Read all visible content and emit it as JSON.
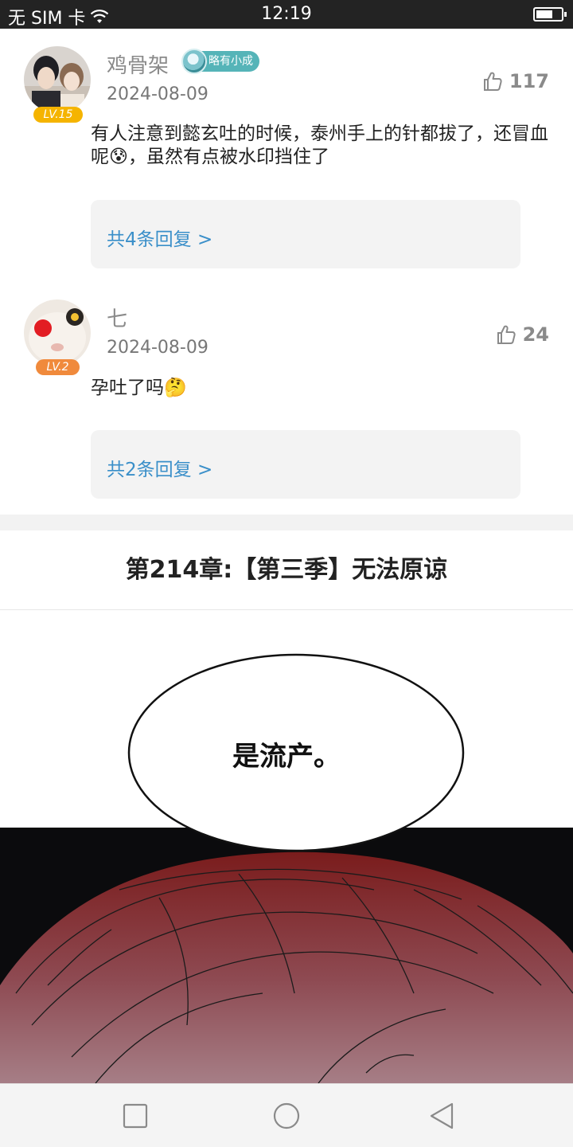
{
  "status_bar": {
    "carrier": "无 SIM 卡",
    "time": "12:19"
  },
  "comments": [
    {
      "username": "鸡骨架",
      "level": "LV.15",
      "level_color": "#f5b400",
      "title_badge": "略有小成",
      "date": "2024-08-09",
      "likes": "117",
      "text": "有人注意到懿玄吐的时候，泰州手上的针都拔了，还冒血呢😰，虽然有点被水印挡住了",
      "replies": "共4条回复 >"
    },
    {
      "username": "七",
      "level": "LV.2",
      "level_color": "#f08a3c",
      "date": "2024-08-09",
      "likes": "24",
      "text": "孕吐了吗🤔",
      "replies": "共2条回复 >"
    }
  ],
  "chapter": {
    "title": "第214章:【第三季】无法原谅"
  },
  "comic": {
    "speech": "是流产。"
  },
  "icons": {
    "thumb": "thumbs-up-icon",
    "nav": [
      "square-icon",
      "circle-icon",
      "back-triangle-icon"
    ]
  },
  "colors": {
    "link": "#3a8fc9",
    "badge": "#55b4b8"
  }
}
